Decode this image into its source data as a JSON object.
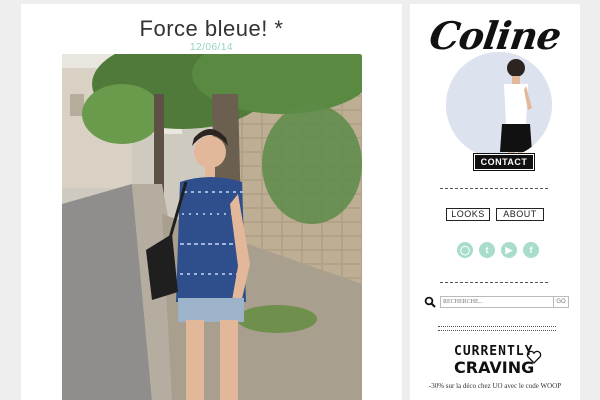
{
  "post": {
    "title": "Force bleue! *",
    "date": "12/06/14"
  },
  "sidebar": {
    "logo": "Coline",
    "contact_label": "CONTACT",
    "nav": [
      {
        "label": "LOOKS"
      },
      {
        "label": "ABOUT"
      }
    ],
    "social_icons": [
      "instagram-icon",
      "twitter-icon",
      "youtube-icon",
      "facebook-icon"
    ],
    "search": {
      "placeholder": "RECHERCHE...",
      "button_label": "GO"
    },
    "craving": {
      "line1": "CURRENTLY",
      "line2": "CRAVING",
      "promo": "-30% sur la déco chez UO avec le code WOOP"
    }
  },
  "colors": {
    "accent": "#8fd3c1",
    "social": "#a8dccb",
    "background": "#eeeeee"
  }
}
